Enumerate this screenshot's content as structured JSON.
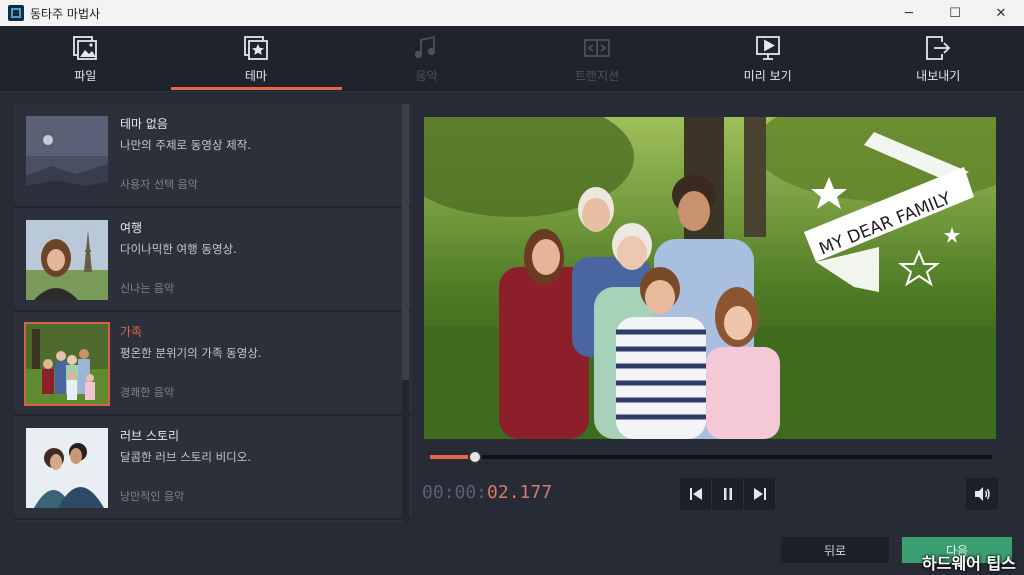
{
  "window": {
    "title": "동타주 마법사"
  },
  "window_controls": {
    "minimize": "─",
    "maximize": "☐",
    "close": "✕"
  },
  "nav": [
    {
      "label": "파일",
      "icon": "file-image-icon",
      "state": "enabled"
    },
    {
      "label": "테마",
      "icon": "theme-star-icon",
      "state": "active"
    },
    {
      "label": "음악",
      "icon": "music-note-icon",
      "state": "disabled"
    },
    {
      "label": "트랜지션",
      "icon": "transition-icon",
      "state": "disabled"
    },
    {
      "label": "미리 보기",
      "icon": "preview-play-icon",
      "state": "enabled"
    },
    {
      "label": "내보내기",
      "icon": "export-icon",
      "state": "enabled"
    }
  ],
  "themes": [
    {
      "title": "테마 없음",
      "desc": "나만의 주제로 동영상 제작.",
      "music": "사용자 선택 음악",
      "selected": false
    },
    {
      "title": "여행",
      "desc": "다이나믹한 여행 동영상.",
      "music": "신나는 음악",
      "selected": false
    },
    {
      "title": "가족",
      "desc": "평온한 분위기의 가족 동영상.",
      "music": "경쾌한 음악",
      "selected": true
    },
    {
      "title": "러브 스토리",
      "desc": "달콤한 러브 스토리 비디오.",
      "music": "낭만적인 음악",
      "selected": false
    }
  ],
  "preview": {
    "banner_text": "MY DEAR FAMILY"
  },
  "player": {
    "time_dim": "00:00:",
    "time_hi": "02.177",
    "progress": 0.08
  },
  "footer": {
    "back_label": "뒤로",
    "next_label": "다음",
    "watermark": "하드웨어 팁스"
  },
  "colors": {
    "accent": "#e5664f",
    "next_button": "#3a9e70",
    "background": "#262b36"
  }
}
